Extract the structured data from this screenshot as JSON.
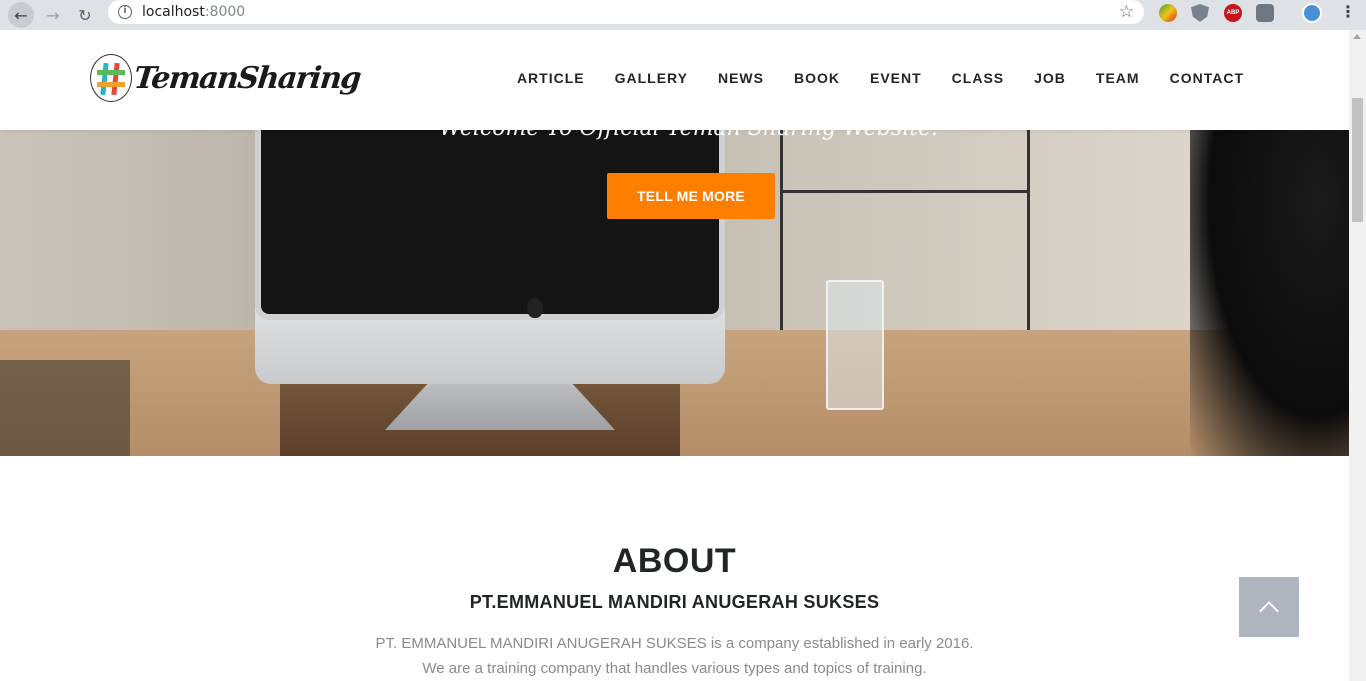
{
  "browser": {
    "url_host": "localhost",
    "url_port": ":8000",
    "ext3_label": "ABP"
  },
  "header": {
    "logo_text": "TemanSharing",
    "nav": [
      "ARTICLE",
      "GALLERY",
      "NEWS",
      "BOOK",
      "EVENT",
      "CLASS",
      "JOB",
      "TEAM",
      "CONTACT"
    ]
  },
  "hero": {
    "tagline": "Welcome To Official Teman Sharing Website!",
    "button_label": "TELL ME MORE"
  },
  "about": {
    "title": "ABOUT",
    "subtitle": "PT.EMMANUEL MANDIRI ANUGERAH SUKSES",
    "line1": "PT. EMMANUEL MANDIRI ANUGERAH SUKSES is a company established in early 2016.",
    "line2": "We are a training company that handles various types and topics of training."
  },
  "colors": {
    "accent": "#fe7f00",
    "text_dark": "#212529",
    "text_muted": "#8a8a8a"
  }
}
